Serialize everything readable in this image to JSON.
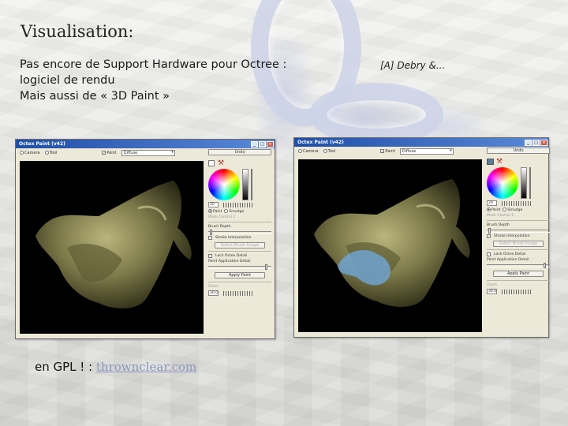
{
  "slide": {
    "title": "Visualisation:",
    "body_lines": [
      "Pas encore de Support Hardware pour Octree :",
      "logiciel de rendu",
      "Mais aussi de « 3D Paint »"
    ],
    "citation": "[A] Debry &...",
    "footer_prefix": "en GPL ! : ",
    "footer_link": "thrownclear.com"
  },
  "windows": [
    {
      "title": "Octex Paint (v42)",
      "toolbar": {
        "camera": "Camera",
        "tool": "Tool",
        "paint": "Paint",
        "mode": "Diffuse"
      },
      "panel": {
        "undo": "Undo",
        "size_value": "20",
        "paint_radio": "Paint",
        "smudge_radio": "Smudge",
        "mask_label": "Mask Control 1",
        "brush_depth": "Brush Depth",
        "stroke_interp": "Stroke Interpolation",
        "stroke_checked": false,
        "select_brush": "Select Brush Image",
        "lock_detail": "Lock Octex Detail",
        "app_detail": "Paint Application Detail",
        "apply": "Apply Paint",
        "zoom_label": "Zoom",
        "zoom_value": "30.0"
      },
      "paint_stroke": false
    },
    {
      "title": "Octex Paint (v42)",
      "toolbar": {
        "camera": "Camera",
        "tool": "Tool",
        "paint": "Paint",
        "mode": "Diffuse"
      },
      "panel": {
        "undo": "Undo",
        "size_value": "20",
        "paint_radio": "Paint",
        "smudge_radio": "Smudge",
        "mask_label": "Mask Control 1",
        "brush_depth": "Brush Depth",
        "stroke_interp": "Stroke Interpolation",
        "stroke_checked": true,
        "select_brush": "Select Brush Image",
        "lock_detail": "Lock Octex Detail",
        "app_detail": "Paint Application Detail",
        "apply": "Apply Paint",
        "zoom_label": "Zoom",
        "zoom_value": "30.0"
      },
      "paint_stroke": true
    }
  ],
  "colors": {
    "titlebar": "#1f4ea8",
    "window_bg": "#ece9d8",
    "link": "#8d97bf",
    "paint_stroke": "#6fa6d8"
  }
}
